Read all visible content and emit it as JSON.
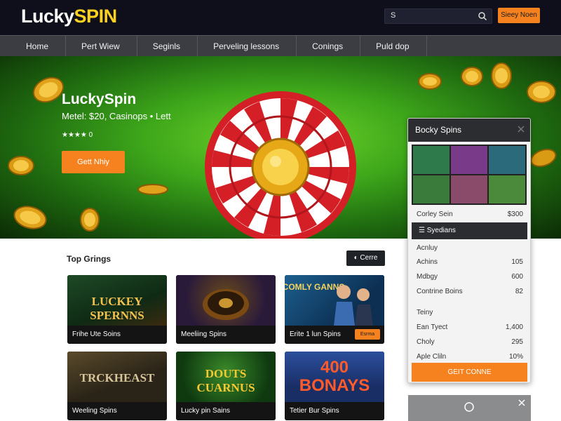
{
  "header": {
    "logo_part1": "Lucky",
    "logo_part2": "SPIN",
    "search_value": "S",
    "signup_label": "Sieey Noen"
  },
  "nav": {
    "items": [
      "Home",
      "Pert Wiew",
      "Seginls",
      "Perveling lessons",
      "Conings",
      "Puld dop"
    ]
  },
  "hero": {
    "title": "LuckySpin",
    "subtitle": "Metel: $20, Casinops • Lett",
    "rating": "★★★★ 0",
    "cta_label": "Gett Nhiy"
  },
  "games": {
    "heading": "Top Grings",
    "button_label": "Cerre",
    "cards": [
      {
        "title": "Frihe Ute Soins",
        "art": "LUCKEY SPERNNS"
      },
      {
        "title": "Meeliing Spins",
        "art": ""
      },
      {
        "title": "Erite 1 lun Spins",
        "art": "COMLY GANNS",
        "tag": "Esrma"
      },
      {
        "title": "Weeling Spins",
        "art": "TRCKHEAST"
      },
      {
        "title": "Lucky pin Sains",
        "art": "DOUTS CUARNUS"
      },
      {
        "title": "Tetier Bur Spins",
        "art": "400 BONAYS"
      }
    ]
  },
  "panel": {
    "title": "Bocky Spins",
    "label_row": {
      "label": "Corley Sein",
      "value": "$300"
    },
    "section_title": "Syedians",
    "rows": [
      {
        "label": "Acnluy",
        "value": ""
      },
      {
        "label": "Achins",
        "value": "105"
      },
      {
        "label": "Mdbgy",
        "value": "600"
      },
      {
        "label": "Contrine Boins",
        "value": "82"
      },
      {
        "label": "Teiny",
        "value": ""
      },
      {
        "label": "Ean Tyect",
        "value": "1,400"
      },
      {
        "label": "Choly",
        "value": "295"
      },
      {
        "label": "Aple Cliln",
        "value": "10%"
      }
    ],
    "cta_label": "GEIT CONNE"
  }
}
